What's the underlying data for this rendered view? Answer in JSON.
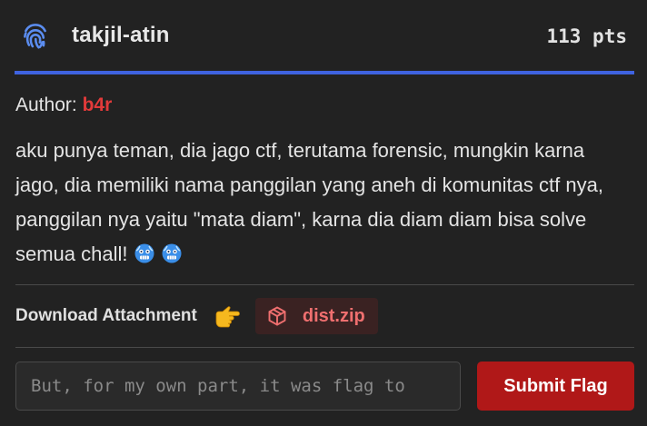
{
  "challenge": {
    "title": "takjil-atin",
    "points": "113 pts",
    "icon": "fingerprint-icon"
  },
  "author": {
    "label": "Author:",
    "name": "b4r"
  },
  "description": "aku punya teman, dia jago ctf, terutama forensic, mungkin karna jago, dia memiliki nama panggilan yang aneh di komunitas ctf nya, panggilan nya yaitu \"mata diam\", karna dia diam diam bisa solve semua chall!",
  "attachment": {
    "label": "Download Attachment",
    "file_name": "dist.zip",
    "icon": "package-icon"
  },
  "flag_form": {
    "placeholder": "But, for my own part, it was flag to",
    "value": "",
    "submit_label": "Submit Flag"
  },
  "colors": {
    "accent": "#3f63e0",
    "author": "#e23a3a",
    "submit": "#b01818",
    "file": "#ef6f6f"
  }
}
